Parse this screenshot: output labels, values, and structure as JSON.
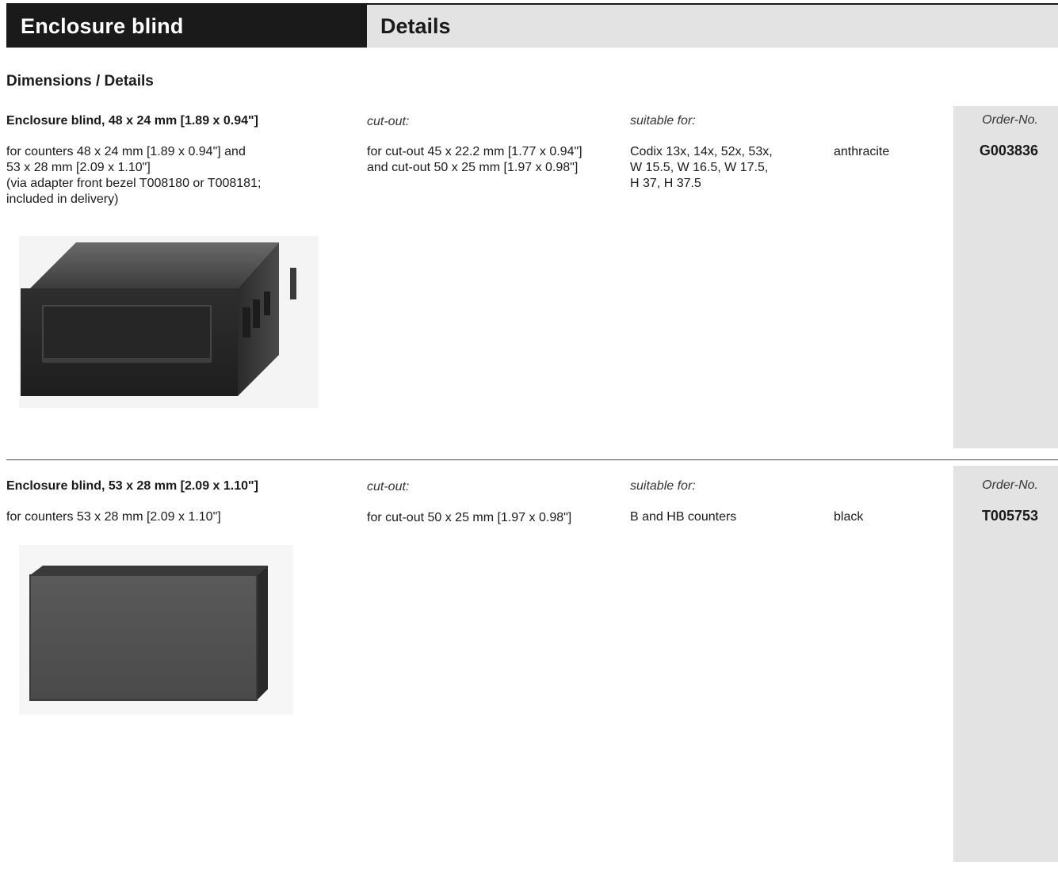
{
  "header": {
    "left_title": "Enclosure blind",
    "right_title": "Details"
  },
  "section_title": "Dimensions / Details",
  "labels": {
    "cutout": "cut-out:",
    "suitable": "suitable for:",
    "order": "Order-No."
  },
  "products": [
    {
      "title": "Enclosure blind, 48 x 24 mm [1.89 x 0.94\"]",
      "description": "for counters 48 x 24 mm [1.89 x 0.94\"] and\n53 x 28 mm [2.09 x 1.10\"]\n(via adapter front bezel T008180 or T008181;\nincluded in delivery)",
      "cutout": "for cut-out 45 x 22.2 mm [1.77 x 0.94\"]\nand cut-out 50 x 25 mm [1.97 x 0.98\"]",
      "suitable": "Codix 13x, 14x, 52x, 53x,\nW 15.5, W 16.5, W 17.5,\nH 37, H 37.5",
      "color": "anthracite",
      "order_no": "G003836"
    },
    {
      "title": "Enclosure blind, 53 x 28 mm [2.09 x 1.10\"]",
      "description": "for counters 53 x 28 mm [2.09 x 1.10\"]",
      "cutout": "for cut-out 50 x 25 mm [1.97 x 0.98\"]",
      "suitable": "B and HB counters",
      "color": "black",
      "order_no": "T005753"
    }
  ]
}
